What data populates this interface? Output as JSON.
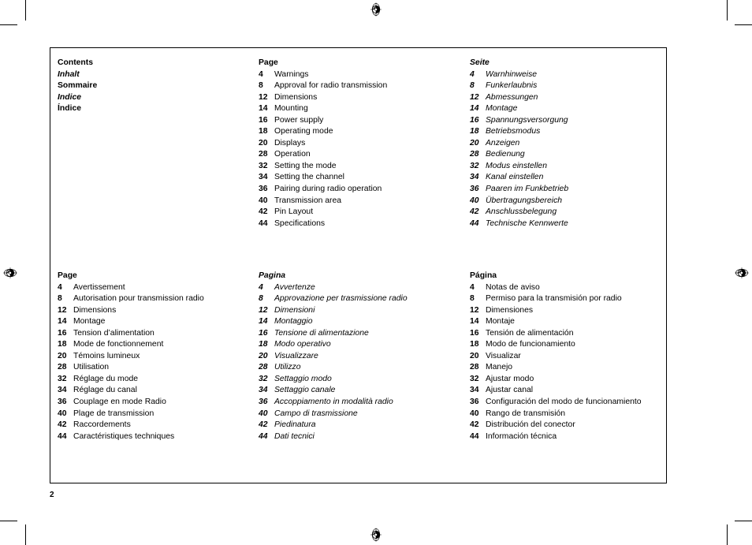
{
  "page": {
    "folio": "2",
    "marks": {
      "registration_icon": "registration-target-icon",
      "crop_mark_icon": "crop-mark-icon"
    }
  },
  "contents_labels": {
    "heading": "Contents",
    "languages": [
      {
        "label": "Inhalt",
        "style": "italic"
      },
      {
        "label": "Sommaire",
        "style": "normal"
      },
      {
        "label": "Indice",
        "style": "italic"
      },
      {
        "label": "Índice",
        "style": "normal"
      }
    ]
  },
  "columns": {
    "english": {
      "head": "Page",
      "entries": [
        {
          "page": "4",
          "title": "Warnings"
        },
        {
          "page": "8",
          "title": "Approval for radio transmission"
        },
        {
          "page": "12",
          "title": "Dimensions"
        },
        {
          "page": "14",
          "title": "Mounting"
        },
        {
          "page": "16",
          "title": "Power supply"
        },
        {
          "page": "18",
          "title": "Operating mode"
        },
        {
          "page": "20",
          "title": "Displays"
        },
        {
          "page": "28",
          "title": "Operation"
        },
        {
          "page": "32",
          "title": "Setting the mode"
        },
        {
          "page": "34",
          "title": "Setting the channel"
        },
        {
          "page": "36",
          "title": "Pairing during radio operation"
        },
        {
          "page": "40",
          "title": "Transmission area"
        },
        {
          "page": "42",
          "title": "Pin Layout"
        },
        {
          "page": "44",
          "title": "Specifications"
        }
      ]
    },
    "german": {
      "head": "Seite",
      "entries": [
        {
          "page": "4",
          "title": "Warnhinweise"
        },
        {
          "page": "8",
          "title": "Funkerlaubnis"
        },
        {
          "page": "12",
          "title": "Abmessungen"
        },
        {
          "page": "14",
          "title": "Montage"
        },
        {
          "page": "16",
          "title": "Spannungsversorgung"
        },
        {
          "page": "18",
          "title": "Betriebsmodus"
        },
        {
          "page": "20",
          "title": "Anzeigen"
        },
        {
          "page": "28",
          "title": "Bedienung"
        },
        {
          "page": "32",
          "title": "Modus einstellen"
        },
        {
          "page": "34",
          "title": "Kanal einstellen"
        },
        {
          "page": "36",
          "title": "Paaren im Funkbetrieb"
        },
        {
          "page": "40",
          "title": "Übertragungsbereich"
        },
        {
          "page": "42",
          "title": "Anschlussbelegung"
        },
        {
          "page": "44",
          "title": "Technische Kennwerte"
        }
      ]
    },
    "french": {
      "head": "Page",
      "entries": [
        {
          "page": "4",
          "title": "Avertissement"
        },
        {
          "page": "8",
          "title": "Autorisation pour transmission radio"
        },
        {
          "page": "12",
          "title": "Dimensions"
        },
        {
          "page": "14",
          "title": "Montage"
        },
        {
          "page": "16",
          "title": "Tension d’alimentation"
        },
        {
          "page": "18",
          "title": "Mode de fonctionnement"
        },
        {
          "page": "20",
          "title": "Témoins lumineux"
        },
        {
          "page": "28",
          "title": "Utilisation"
        },
        {
          "page": "32",
          "title": "Réglage du mode"
        },
        {
          "page": "34",
          "title": "Réglage du canal"
        },
        {
          "page": "36",
          "title": "Couplage en mode Radio"
        },
        {
          "page": "40",
          "title": "Plage de transmission"
        },
        {
          "page": "42",
          "title": "Raccordements"
        },
        {
          "page": "44",
          "title": "Caractéristiques techniques"
        }
      ]
    },
    "italian": {
      "head": "Pagina",
      "entries": [
        {
          "page": "4",
          "title": "Avvertenze"
        },
        {
          "page": "8",
          "title": "Approvazione per trasmissione radio"
        },
        {
          "page": "12",
          "title": "Dimensioni"
        },
        {
          "page": "14",
          "title": "Montaggio"
        },
        {
          "page": "16",
          "title": "Tensione di alimentazione"
        },
        {
          "page": "18",
          "title": "Modo operativo"
        },
        {
          "page": "20",
          "title": "Visualizzare"
        },
        {
          "page": "28",
          "title": "Utilizzo"
        },
        {
          "page": "32",
          "title": "Settaggio modo"
        },
        {
          "page": "34",
          "title": "Settaggio canale"
        },
        {
          "page": "36",
          "title": "Accoppiamento in modalità radio"
        },
        {
          "page": "40",
          "title": "Campo di trasmissione"
        },
        {
          "page": "42",
          "title": "Piedinatura"
        },
        {
          "page": "44",
          "title": "Dati tecnici"
        }
      ]
    },
    "spanish": {
      "head": "Página",
      "entries": [
        {
          "page": "4",
          "title": "Notas de aviso"
        },
        {
          "page": "8",
          "title": "Permiso para la transmisión por radio"
        },
        {
          "page": "12",
          "title": "Dimensiones"
        },
        {
          "page": "14",
          "title": "Montaje"
        },
        {
          "page": "16",
          "title": "Tensión de alimentación"
        },
        {
          "page": "18",
          "title": "Modo de funcionamiento"
        },
        {
          "page": "20",
          "title": "Visualizar"
        },
        {
          "page": "28",
          "title": "Manejo"
        },
        {
          "page": "32",
          "title": "Ajustar modo"
        },
        {
          "page": "34",
          "title": "Ajustar canal"
        },
        {
          "page": "36",
          "title": "Configuración del modo de funcionamiento"
        },
        {
          "page": "40",
          "title": "Rango de transmisión"
        },
        {
          "page": "42",
          "title": "Distribución del conector"
        },
        {
          "page": "44",
          "title": "Información técnica"
        }
      ]
    }
  }
}
